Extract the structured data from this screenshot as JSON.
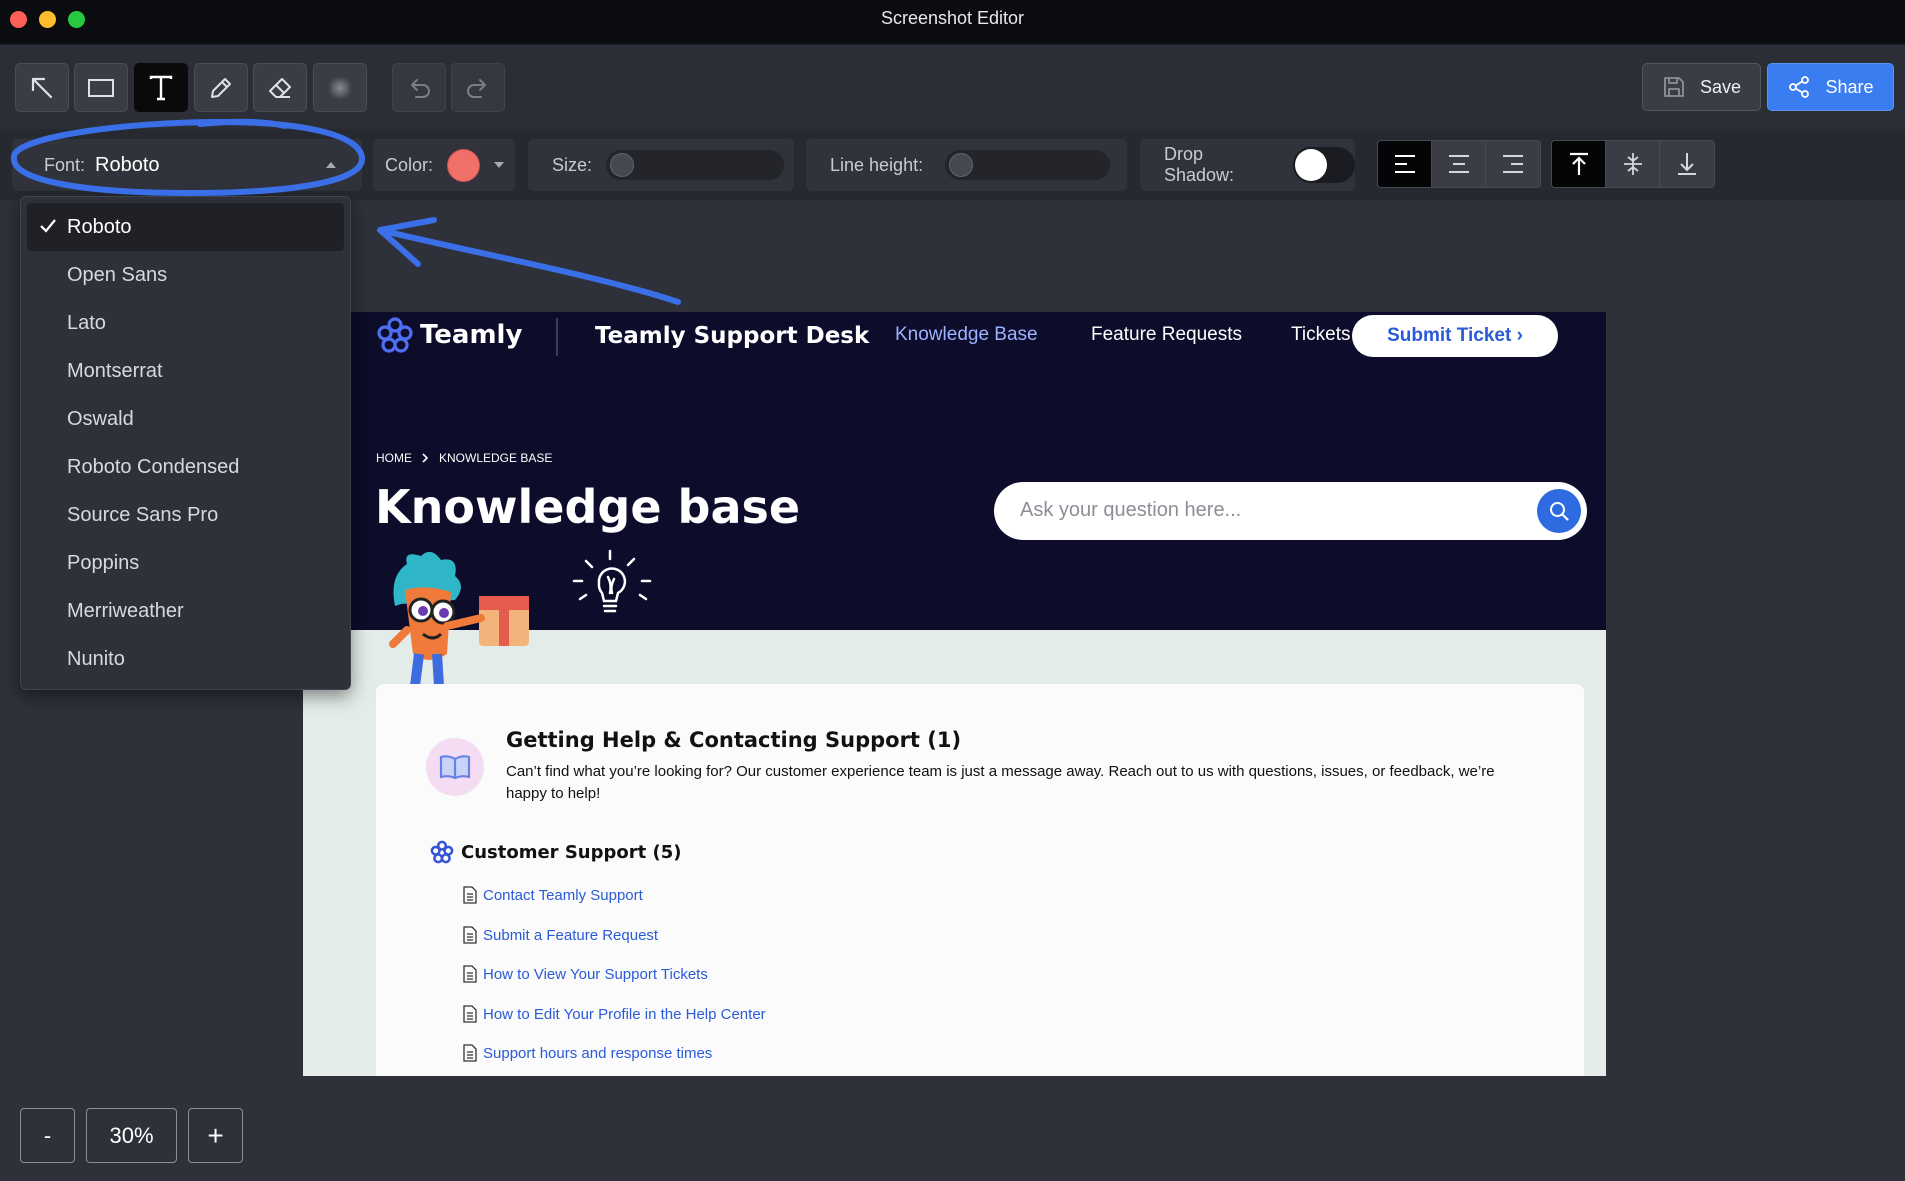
{
  "window": {
    "title": "Screenshot Editor"
  },
  "toolbar": {
    "tools": [
      "arrow-tool",
      "rectangle-tool",
      "text-tool",
      "pencil-tool",
      "eraser-tool",
      "blur-tool"
    ],
    "save_label": "Save",
    "share_label": "Share"
  },
  "formatbar": {
    "font_label": "Font:",
    "font_value": "Roboto",
    "color_label": "Color:",
    "color_value": "#f07068",
    "size_label": "Size:",
    "size_value": 0,
    "line_height_label": "Line height:",
    "line_height_value": 0,
    "drop_shadow_label": "Drop Shadow:",
    "drop_shadow_on": false,
    "text_align": "left",
    "vertical_align": "top"
  },
  "font_dropdown": {
    "selected": "Roboto",
    "options": [
      "Roboto",
      "Open Sans",
      "Lato",
      "Montserrat",
      "Oswald",
      "Roboto Condensed",
      "Source Sans Pro",
      "Poppins",
      "Merriweather",
      "Nunito"
    ]
  },
  "preview": {
    "brand": "Teamly",
    "desk_title": "Teamly Support Desk",
    "nav": [
      "Knowledge Base",
      "Feature Requests",
      "Tickets"
    ],
    "submit_label": "Submit Ticket ›",
    "breadcrumb": [
      "HOME",
      "KNOWLEDGE BASE"
    ],
    "page_title": "Knowledge base",
    "search_placeholder": "Ask your question here...",
    "section_title": "Getting Help & Contacting Support (1)",
    "section_desc": "Can’t find what you’re looking for? Our customer experience team is just a message away. Reach out to us with questions, issues, or feedback, we’re happy to help!",
    "subsection_title": "Customer Support (5)",
    "articles": [
      "Contact Teamly Support",
      "Submit a Feature Request",
      "How to View Your Support Tickets",
      "How to Edit Your Profile in the Help Center",
      "Support hours and response times"
    ]
  },
  "zoom": {
    "minus_label": "-",
    "value": "30%",
    "plus_label": "+"
  },
  "colors": {
    "accent": "#3a7df0",
    "annotation": "#3a6fe8",
    "link": "#2a5bd7",
    "hero_bg": "#0d0c2b"
  }
}
